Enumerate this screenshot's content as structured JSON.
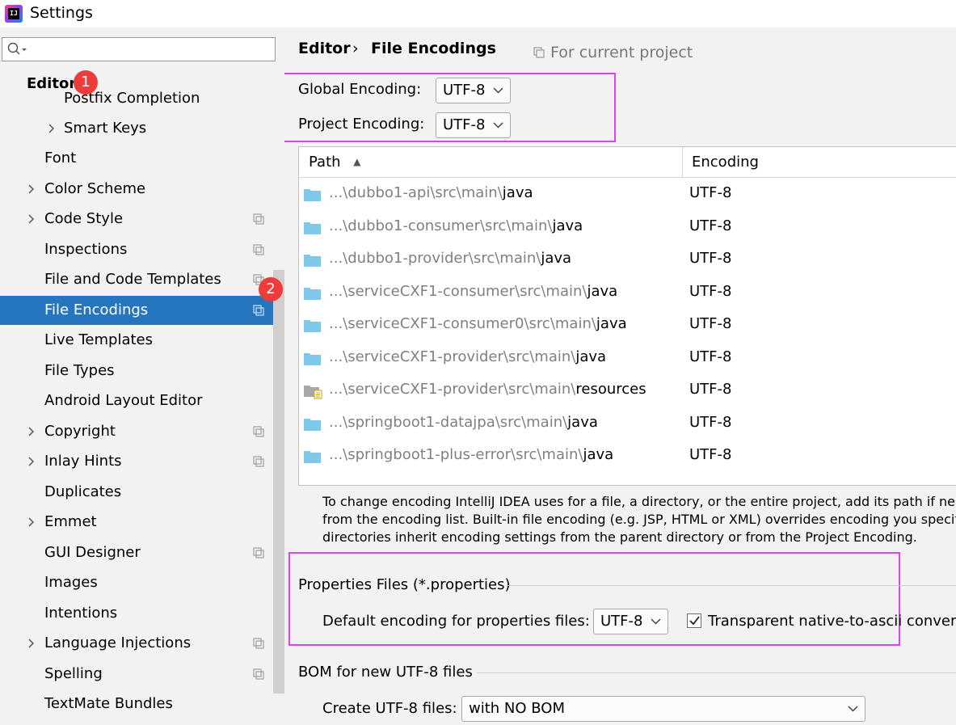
{
  "window": {
    "title": "Settings"
  },
  "search": {
    "placeholder": ""
  },
  "sidebar": {
    "section_label": "Editor",
    "items": [
      {
        "label": "Postfix Completion",
        "expandable": false,
        "project_scope": false
      },
      {
        "label": "Smart Keys",
        "expandable": true,
        "project_scope": false
      },
      {
        "label": "Font",
        "expandable": false,
        "project_scope": false
      },
      {
        "label": "Color Scheme",
        "expandable": true,
        "project_scope": false
      },
      {
        "label": "Code Style",
        "expandable": true,
        "project_scope": true
      },
      {
        "label": "Inspections",
        "expandable": false,
        "project_scope": true
      },
      {
        "label": "File and Code Templates",
        "expandable": false,
        "project_scope": true
      },
      {
        "label": "File Encodings",
        "expandable": false,
        "project_scope": true,
        "selected": true
      },
      {
        "label": "Live Templates",
        "expandable": false,
        "project_scope": false
      },
      {
        "label": "File Types",
        "expandable": false,
        "project_scope": false
      },
      {
        "label": "Android Layout Editor",
        "expandable": false,
        "project_scope": false
      },
      {
        "label": "Copyright",
        "expandable": true,
        "project_scope": true
      },
      {
        "label": "Inlay Hints",
        "expandable": true,
        "project_scope": true
      },
      {
        "label": "Duplicates",
        "expandable": false,
        "project_scope": false
      },
      {
        "label": "Emmet",
        "expandable": true,
        "project_scope": false
      },
      {
        "label": "GUI Designer",
        "expandable": false,
        "project_scope": true
      },
      {
        "label": "Images",
        "expandable": false,
        "project_scope": false
      },
      {
        "label": "Intentions",
        "expandable": false,
        "project_scope": false
      },
      {
        "label": "Language Injections",
        "expandable": true,
        "project_scope": true
      },
      {
        "label": "Spelling",
        "expandable": false,
        "project_scope": true
      },
      {
        "label": "TextMate Bundles",
        "expandable": false,
        "project_scope": false
      }
    ]
  },
  "annotations": {
    "badge1": "1",
    "badge2": "2"
  },
  "breadcrumb": {
    "parent": "Editor",
    "separator": "›",
    "current": "File Encodings",
    "scope": "For current project"
  },
  "encoding": {
    "global_label": "Global Encoding:",
    "global_value": "UTF-8",
    "project_label": "Project Encoding:",
    "project_value": "UTF-8"
  },
  "table": {
    "columns": [
      "Path",
      "Encoding"
    ],
    "sort_indicator": "▲",
    "rows": [
      {
        "prefix": "...\\dubbo1-api\\src\\main\\",
        "name": "java",
        "encoding": "UTF-8",
        "icon": "source-folder-icon"
      },
      {
        "prefix": "...\\dubbo1-consumer\\src\\main\\",
        "name": "java",
        "encoding": "UTF-8",
        "icon": "source-folder-icon"
      },
      {
        "prefix": "...\\dubbo1-provider\\src\\main\\",
        "name": "java",
        "encoding": "UTF-8",
        "icon": "source-folder-icon"
      },
      {
        "prefix": "...\\serviceCXF1-consumer\\src\\main\\",
        "name": "java",
        "encoding": "UTF-8",
        "icon": "source-folder-icon"
      },
      {
        "prefix": "...\\serviceCXF1-consumer0\\src\\main\\",
        "name": "java",
        "encoding": "UTF-8",
        "icon": "source-folder-icon"
      },
      {
        "prefix": "...\\serviceCXF1-provider\\src\\main\\",
        "name": "java",
        "encoding": "UTF-8",
        "icon": "source-folder-icon"
      },
      {
        "prefix": "...\\serviceCXF1-provider\\src\\main\\",
        "name": "resources",
        "encoding": "UTF-8",
        "icon": "resources-folder-icon"
      },
      {
        "prefix": "...\\springboot1-datajpa\\src\\main\\",
        "name": "java",
        "encoding": "UTF-8",
        "icon": "source-folder-icon"
      },
      {
        "prefix": "...\\springboot1-plus-error\\src\\main\\",
        "name": "java",
        "encoding": "UTF-8",
        "icon": "source-folder-icon"
      }
    ]
  },
  "description": {
    "line1": "To change encoding IntelliJ IDEA uses for a file, a directory, or the entire project, add its path if necessa",
    "line2": "from the encoding list. Built-in file encoding (e.g. JSP, HTML or XML) overrides encoding you specify he",
    "line3": "directories inherit encoding settings from the parent directory or from the Project Encoding."
  },
  "properties": {
    "section_title": "Properties Files (*.properties)",
    "default_label": "Default encoding for properties files:",
    "default_value": "UTF-8",
    "native_label": "Transparent native-to-ascii conversi",
    "native_checked": true
  },
  "bom": {
    "section_title": "BOM for new UTF-8 files",
    "create_label": "Create UTF-8 files:",
    "create_value": "with NO BOM"
  },
  "colors": {
    "selection": "#2675bf",
    "highlight_box": "#e040fb",
    "badge": "#ef3b3b",
    "folder": "#7ec8ea"
  }
}
